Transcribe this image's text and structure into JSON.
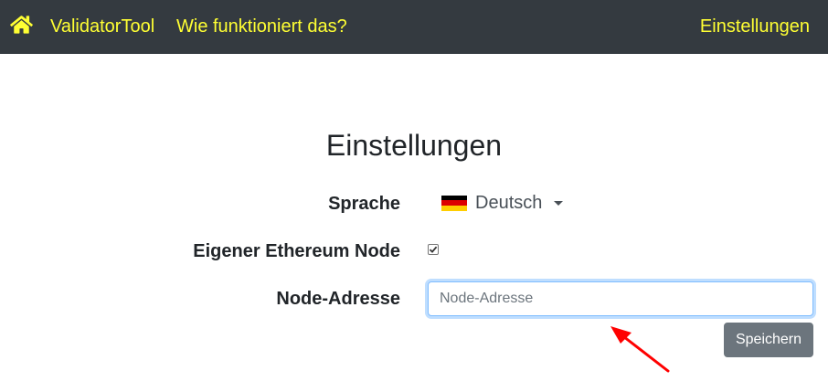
{
  "navbar": {
    "home_icon": "home-icon",
    "brand": "ValidatorTool",
    "how_it_works": "Wie funktioniert das?",
    "settings": "Einstellungen",
    "background_color": "#343a40",
    "link_color": "#ffff33"
  },
  "page": {
    "title": "Einstellungen"
  },
  "form": {
    "language_label": "Sprache",
    "language_value": "Deutsch",
    "language_flag_icon": "flag-germany-icon",
    "own_node_label": "Eigener Ethereum Node",
    "own_node_checked": true,
    "node_address_label": "Node-Adresse",
    "node_address_value": "",
    "node_address_placeholder": "Node-Adresse",
    "save_label": "Speichern"
  },
  "annotation": {
    "arrow_icon": "red-arrow-icon",
    "arrow_color": "#ff0000"
  }
}
